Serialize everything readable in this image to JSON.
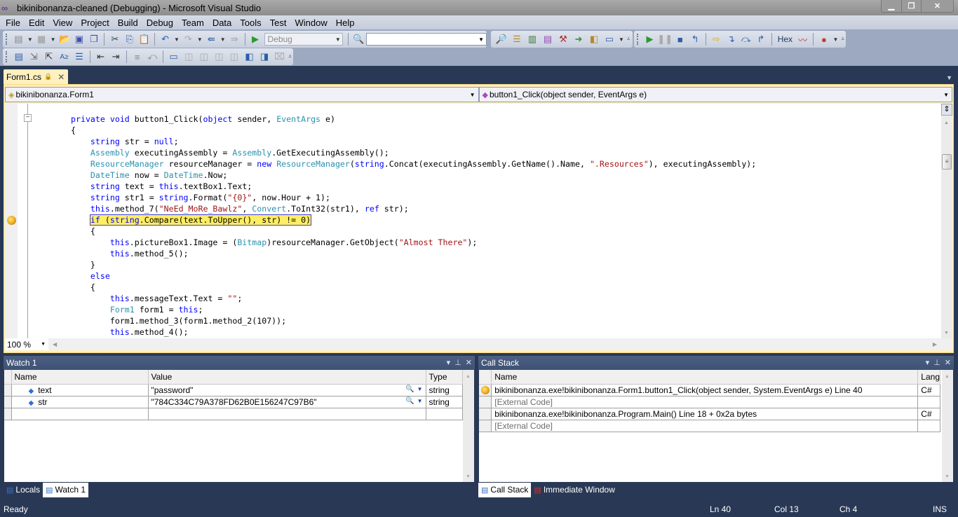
{
  "window": {
    "title": "bikinibonanza-cleaned (Debugging) - Microsoft Visual Studio",
    "logo_icon": "visual-studio-infinity-icon",
    "controls": [
      "minimize",
      "restore",
      "close"
    ]
  },
  "menu": [
    "File",
    "Edit",
    "View",
    "Project",
    "Build",
    "Debug",
    "Team",
    "Data",
    "Tools",
    "Test",
    "Window",
    "Help"
  ],
  "toolbar": {
    "config_value": "Debug",
    "find_value": "",
    "hex_label": "Hex"
  },
  "document": {
    "tab_label": "Form1.cs",
    "type_combo": "bikinibonanza.Form1",
    "member_combo": "button1_Click(object sender, EventArgs e)",
    "zoom_level": "100 %",
    "code_lines": [
      "private void button1_Click(object sender, EventArgs e)",
      "{",
      "    string str = null;",
      "    Assembly executingAssembly = Assembly.GetExecutingAssembly();",
      "    ResourceManager resourceManager = new ResourceManager(string.Concat(executingAssembly.GetName().Name, \".Resources\"), executingAssembly);",
      "    DateTime now = DateTime.Now;",
      "    string text = this.textBox1.Text;",
      "    string str1 = string.Format(\"{0}\", now.Hour + 1);",
      "    this.method_7(\"NeEd_MoRe_Bawlz\", Convert.ToInt32(str1), ref str);",
      "    if (string.Compare(text.ToUpper(), str) != 0)",
      "    {",
      "        this.pictureBox1.Image = (Bitmap)resourceManager.GetObject(\"Almost There\");",
      "        this.method_5();",
      "    }",
      "    else",
      "    {",
      "        this.messageText.Text = \"\";",
      "        Form1 form1 = this;",
      "        form1.method_3(form1.method_2(107));",
      "        this.method_4();"
    ],
    "current_line_index": 9
  },
  "watch": {
    "title": "Watch 1",
    "columns": [
      "Name",
      "Value",
      "Type"
    ],
    "rows": [
      {
        "name": "text",
        "value": "\"password\"",
        "type": "string"
      },
      {
        "name": "str",
        "value": "\"784C334C79A378FD62B0E156247C97B6\"",
        "type": "string"
      }
    ],
    "tabs": [
      "Locals",
      "Watch 1"
    ],
    "active_tab": "Watch 1"
  },
  "callstack": {
    "title": "Call Stack",
    "columns": [
      "Name",
      "Lang"
    ],
    "rows": [
      {
        "name": "bikinibonanza.exe!bikinibonanza.Form1.button1_Click(object sender, System.EventArgs e) Line 40",
        "lang": "C#",
        "current": true
      },
      {
        "name": "[External Code]",
        "lang": "",
        "external": true
      },
      {
        "name": "bikinibonanza.exe!bikinibonanza.Program.Main() Line 18 + 0x2a bytes",
        "lang": "C#"
      },
      {
        "name": "[External Code]",
        "lang": "",
        "external": true
      }
    ],
    "tabs": [
      "Call Stack",
      "Immediate Window"
    ],
    "active_tab": "Call Stack"
  },
  "status": {
    "text": "Ready",
    "line": "Ln 40",
    "col": "Col 13",
    "ch": "Ch 4",
    "mode": "INS"
  },
  "colors": {
    "keyword": "#0000ff",
    "type": "#2b91af",
    "string": "#a31515",
    "current_statement": "#ffee62",
    "chrome": "#293955"
  }
}
